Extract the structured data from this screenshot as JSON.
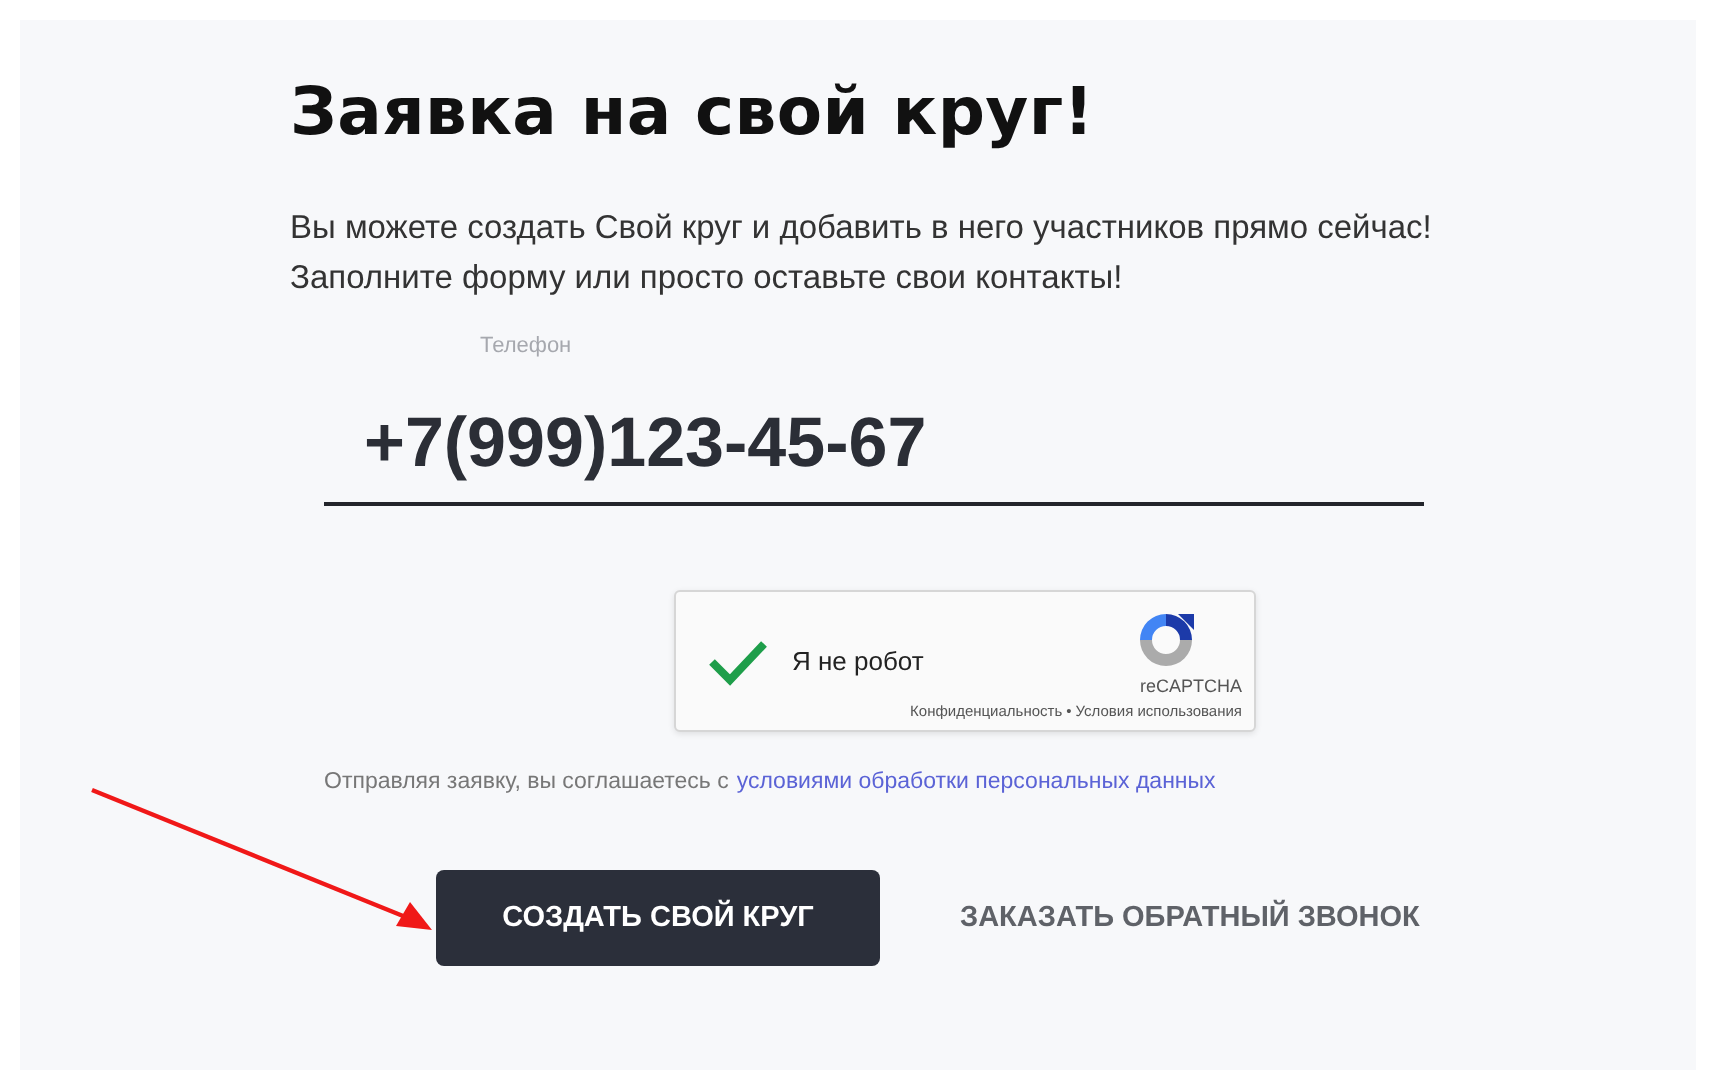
{
  "title": "Заявка на свой круг!",
  "intro": [
    "Вы можете создать Свой круг и добавить в него участников прямо сейчас!",
    "Заполните форму или просто оставьте свои контакты!"
  ],
  "phone": {
    "label": "Телефон",
    "value": "+7(999)123-45-67"
  },
  "captcha": {
    "label": "Я не робот",
    "checked": true,
    "brand": "reCAPTCHA",
    "links": [
      "Конфиденциальность",
      "Условия использования"
    ],
    "separator": "•"
  },
  "consent": {
    "text": "Отправляя заявку, вы соглашаетесь с",
    "link": "условиями обработки персональных данных"
  },
  "buttons": [
    {
      "kind": "primary",
      "label": "СОЗДАТЬ СВОЙ КРУГ"
    },
    {
      "kind": "text",
      "label": "ЗАКАЗАТЬ ОБРАТНЫЙ ЗВОНОК"
    }
  ]
}
